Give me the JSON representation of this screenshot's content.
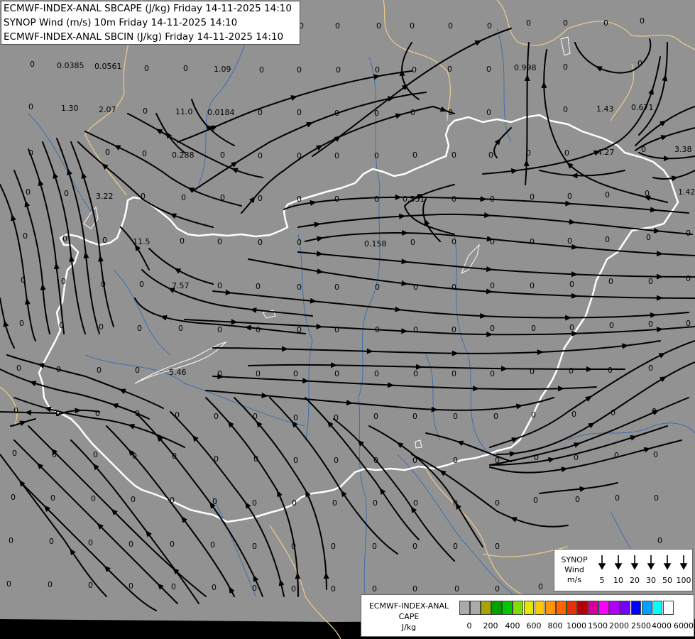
{
  "header": {
    "line1": "ECMWF-INDEX-ANAL SBCAPE (J/kg) Friday 14-11-2025 14:10",
    "line2": "SYNOP Wind (m/s) 10m Friday 14-11-2025 14:10",
    "line3": "ECMWF-INDEX-ANAL SBCIN (J/kg) Friday 14-11-2025 14:10"
  },
  "colors": {
    "background": "#929292",
    "streamline": "#000000",
    "country_border": "#ffffff",
    "neighbor_border": "#e8c88c",
    "river": "#3e6fb0"
  },
  "map_labels": [
    {
      "text": "0.0385"
    },
    {
      "text": "0.0561"
    },
    {
      "text": "1.09"
    },
    {
      "text": "0.998"
    },
    {
      "text": "1.30"
    },
    {
      "text": "2.07"
    },
    {
      "text": "11.0"
    },
    {
      "text": "0.0184"
    },
    {
      "text": "1.43"
    },
    {
      "text": "0.671"
    },
    {
      "text": "0.288"
    },
    {
      "text": "4.27"
    },
    {
      "text": "3.38"
    },
    {
      "text": "3.22"
    },
    {
      "text": "0.551"
    },
    {
      "text": "1.42"
    },
    {
      "text": "11.5"
    },
    {
      "text": "0.158"
    },
    {
      "text": "7.57"
    },
    {
      "text": "5.46"
    }
  ],
  "zero_label": "0",
  "wind_legend": {
    "title": [
      "SYNOP",
      "Wind",
      "m/s"
    ],
    "values": [
      "5",
      "10",
      "20",
      "30",
      "50",
      "100"
    ]
  },
  "cape_legend": {
    "title": [
      "ECMWF-INDEX-ANAL",
      "CAPE",
      "J/kg"
    ],
    "ticks": [
      "0",
      "200",
      "400",
      "600",
      "800",
      "1000",
      "1500",
      "2000",
      "2500",
      "4000",
      "6000"
    ],
    "swatches": [
      "#aaaaaa",
      "#aaaaaa",
      "#a5a500",
      "#00a000",
      "#00c800",
      "#7fe000",
      "#e6e600",
      "#ffc800",
      "#ff9600",
      "#ff6400",
      "#e63200",
      "#b40000",
      "#d2009c",
      "#ff00ff",
      "#b400ff",
      "#7800ff",
      "#0000ff",
      "#00a0ff",
      "#00ffff",
      "#ffffff"
    ]
  }
}
